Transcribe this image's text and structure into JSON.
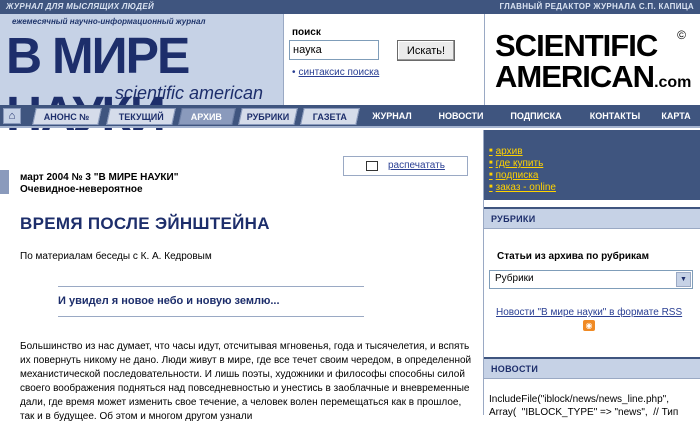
{
  "top_strip": {
    "left": "ЖУРНАЛ ДЛЯ МЫСЛЯЩИХ ЛЮДЕЙ",
    "right": "ГЛАВНЫЙ РЕДАКТОР ЖУРНАЛА С.П. КАПИЦА"
  },
  "logo": {
    "subtitle": "ежемесячный научно-информационный журнал",
    "main": "В МИРЕ НАУКИ",
    "english": "scientific american"
  },
  "search": {
    "title": "поиск",
    "value": "наука",
    "button": "Искать!",
    "syntax_link": "синтаксис поиска"
  },
  "sa": {
    "line1": "SCIENTIFIC",
    "line2": "AMERICAN",
    "com": ".com",
    "copyright": "©"
  },
  "nav": {
    "home_icon": "home-icon",
    "tabs": [
      "АНОНС №",
      "ТЕКУЩИЙ",
      "АРХИВ",
      "РУБРИКИ",
      "ГАЗЕТА",
      "ЖУРНАЛ",
      "НОВОСТИ",
      "ПОДПИСКА",
      "КОНТАКТЫ",
      "КАРТА"
    ]
  },
  "article": {
    "print_label": "распечатать",
    "issue": "март 2004 № 3 \"В МИРЕ НАУКИ\"",
    "rubric": "Очевидное-невероятное",
    "title": "ВРЕМЯ ПОСЛЕ ЭЙНШТЕЙНА",
    "byline": "По материалам беседы с К. А. Кедровым",
    "epigraph": "И увидел я новое небо и новую землю...",
    "body": "Большинство из нас думает, что часы идут, отсчитывая мгновенья, года и тысячелетия, и вспять их повернуть никому не дано. Люди живут в мире, где все течет своим чередом, в определенной механистической последовательности. И лишь поэты, художники и философы способны силой своего воображения подняться над повседневностью и унестись в заоблачные и вневременные дали, где время может изменить свое течение, а человек волен перемещаться как в прошлое, так и в будущее. Об этом и многом другом узнали"
  },
  "sidebar": {
    "links": [
      "архив",
      "где купить",
      "подписка",
      "заказ - online"
    ],
    "rubrics_header": "РУБРИКИ",
    "rubrics_title": "Статьи из архива по рубрикам",
    "select_value": "Рубрики",
    "rss_link": "Новости \"В мире науки\" в формате RSS",
    "news_header": "НОВОСТИ",
    "news_code_1": "IncludeFile(\"iblock/news/news_line.php\",",
    "news_code_2": "Array(  \"IBLOCK_TYPE\" => \"news\",  // Тип"
  },
  "colors": {
    "navy": "#3f557f",
    "light_blue": "#c6d2e6",
    "title_blue": "#1d2e6b",
    "link_yellow": "#ffd200"
  }
}
